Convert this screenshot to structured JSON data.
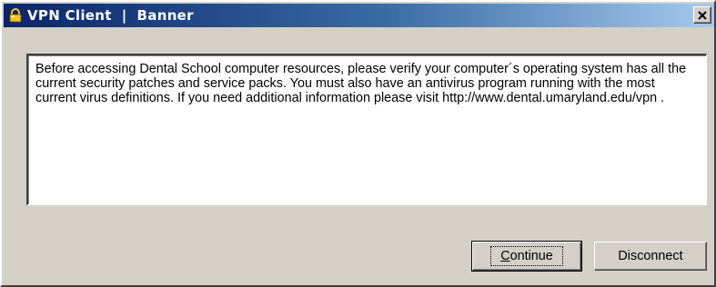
{
  "window": {
    "title": "VPN Client  |  Banner",
    "title_icon": "vpn-lock-icon",
    "close_glyph": "✕"
  },
  "banner": {
    "message": "Before accessing Dental School computer resources, please verify your computer´s operating system has all the current security patches and service packs.  You must also have an antivirus program running with the most current virus definitions.  If you need additional information please visit http://www.dental.umaryland.edu/vpn ."
  },
  "buttons": {
    "continue_label_first": "C",
    "continue_label_rest": "ontinue",
    "disconnect_label": "Disconnect"
  },
  "colors": {
    "title_gradient_start": "#0a246a",
    "title_gradient_end": "#a6caf0",
    "face": "#d4d0c8"
  }
}
